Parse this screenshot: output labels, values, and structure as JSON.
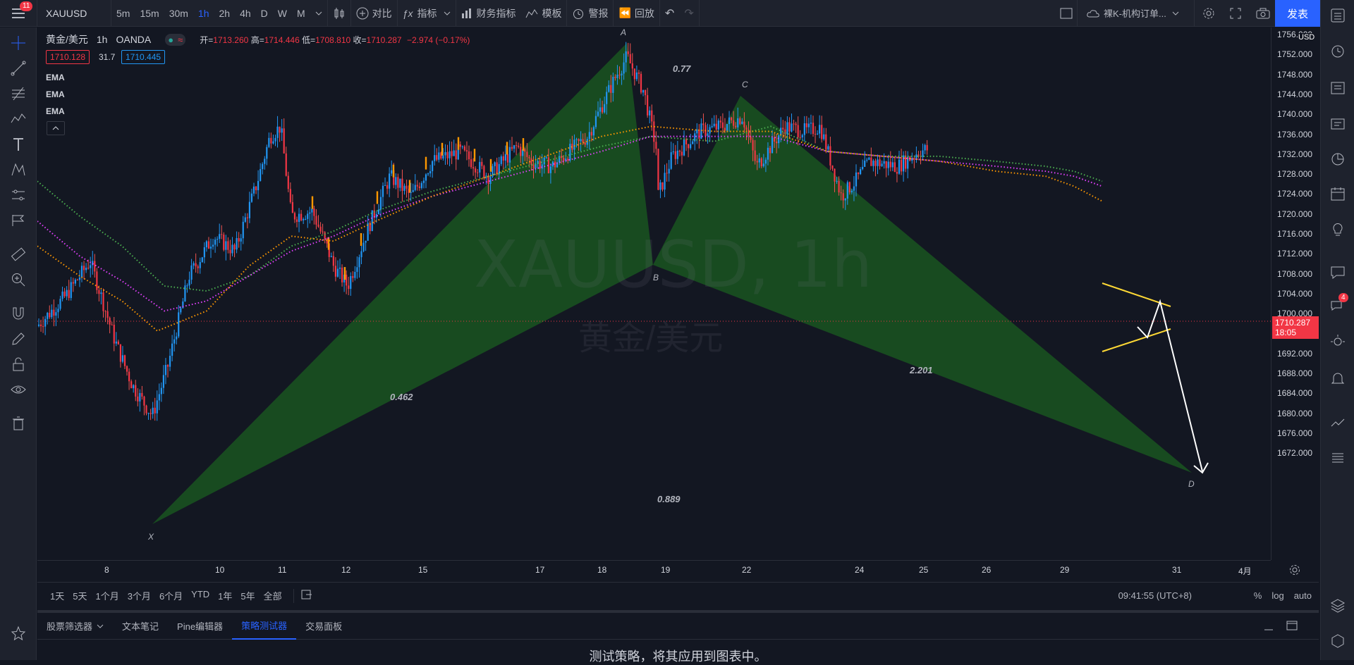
{
  "topbar": {
    "notification_count": "11",
    "symbol": "XAUUSD",
    "intervals": [
      "5m",
      "15m",
      "30m",
      "1h",
      "2h",
      "4h",
      "D",
      "W",
      "M"
    ],
    "active_interval": "1h",
    "compare": "对比",
    "indicators": "指标",
    "financials": "财务指标",
    "templates": "模板",
    "alert": "警报",
    "replay": "回放",
    "layout_name": "裸K-机构订单...",
    "publish": "发表"
  },
  "legend": {
    "name": "黄金/美元",
    "interval": "1h",
    "source": "OANDA",
    "open_label": "开=",
    "open": "1713.260",
    "high_label": "高=",
    "high": "1714.446",
    "low_label": "低=",
    "low": "1708.810",
    "close_label": "收=",
    "close": "1710.287",
    "change": "−2.974 (−0.17%)",
    "bid": "1710.128",
    "spread": "31.7",
    "ask": "1710.445",
    "indicators": [
      "EMA",
      "EMA",
      "EMA"
    ]
  },
  "watermark": {
    "symbol": "XAUUSD, 1h",
    "name": "黄金/美元"
  },
  "pattern": {
    "points": [
      "X",
      "A",
      "B",
      "C",
      "D"
    ],
    "ratios": {
      "xab": "0.77",
      "abc": "0.462",
      "bcd": "2.201",
      "xad": "0.889"
    }
  },
  "price_axis": {
    "currency": "USD",
    "labels": [
      "1756.000",
      "1752.000",
      "1748.000",
      "1744.000",
      "1740.000",
      "1736.000",
      "1732.000",
      "1728.000",
      "1724.000",
      "1720.000",
      "1716.000",
      "1712.000",
      "1708.000",
      "1704.000",
      "1700.000",
      "1696.000",
      "1692.000",
      "1688.000",
      "1684.000",
      "1680.000",
      "1676.000",
      "1672.000"
    ],
    "current_price": "1710.287",
    "countdown": "18:05"
  },
  "time_axis": {
    "labels": [
      "8",
      "10",
      "11",
      "12",
      "15",
      "17",
      "18",
      "19",
      "22",
      "24",
      "25",
      "26",
      "29",
      "31",
      "4月"
    ]
  },
  "range_bar": {
    "ranges": [
      "1天",
      "5天",
      "1个月",
      "3个月",
      "6个月",
      "YTD",
      "1年",
      "5年",
      "全部"
    ],
    "clock": "09:41:55 (UTC+8)",
    "pct": "%",
    "log": "log",
    "auto": "auto"
  },
  "bottom_panel": {
    "tabs": [
      "股票筛选器",
      "文本笔记",
      "Pine编辑器",
      "策略测试器",
      "交易面板"
    ],
    "active_tab": "策略测试器",
    "message": "测试策略，将其应用到图表中。"
  },
  "right_badge": "4",
  "colors": {
    "accent": "#2962ff",
    "down": "#f23645",
    "up": "#2196f3",
    "pattern_fill": "#1b5e20"
  }
}
